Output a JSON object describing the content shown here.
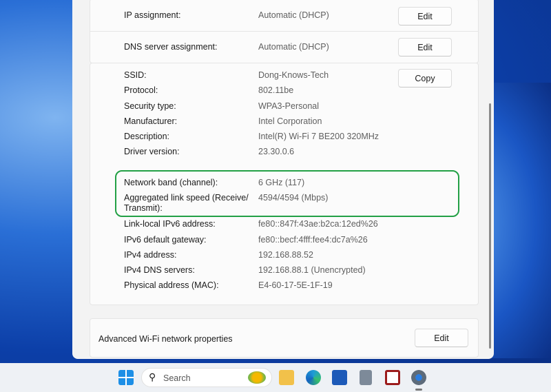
{
  "rows_top": [
    {
      "label": "IP assignment:",
      "value": "Automatic (DHCP)",
      "button": "Edit"
    },
    {
      "label": "DNS server assignment:",
      "value": "Automatic (DHCP)",
      "button": "Edit"
    }
  ],
  "copy_button": "Copy",
  "properties": [
    {
      "label": "SSID:",
      "value": "Dong-Knows-Tech"
    },
    {
      "label": "Protocol:",
      "value": "802.11be"
    },
    {
      "label": "Security type:",
      "value": "WPA3-Personal"
    },
    {
      "label": "Manufacturer:",
      "value": "Intel Corporation"
    },
    {
      "label": "Description:",
      "value": "Intel(R) Wi-Fi 7 BE200 320MHz"
    },
    {
      "label": "Driver version:",
      "value": "23.30.0.6"
    },
    {
      "label": "Network band (channel):",
      "value": "6 GHz (117)"
    },
    {
      "label": "Aggregated link speed (Receive/",
      "label2": "Transmit):",
      "value": "4594/4594 (Mbps)"
    },
    {
      "label": "Link-local IPv6 address:",
      "value": "fe80::847f:43ae:b2ca:12ed%26"
    },
    {
      "label": "IPv6 default gateway:",
      "value": "fe80::becf:4fff:fee4:dc7a%26"
    },
    {
      "label": "IPv4 address:",
      "value": "192.168.88.52"
    },
    {
      "label": "IPv4 DNS servers:",
      "value": "192.168.88.1 (Unencrypted)"
    },
    {
      "label": "Physical address (MAC):",
      "value": "E4-60-17-5E-1F-19"
    }
  ],
  "advanced": {
    "label": "Advanced Wi-Fi network properties",
    "button": "Edit"
  },
  "taskbar": {
    "search_placeholder": "Search"
  },
  "colors": {
    "highlight": "#22a045"
  }
}
